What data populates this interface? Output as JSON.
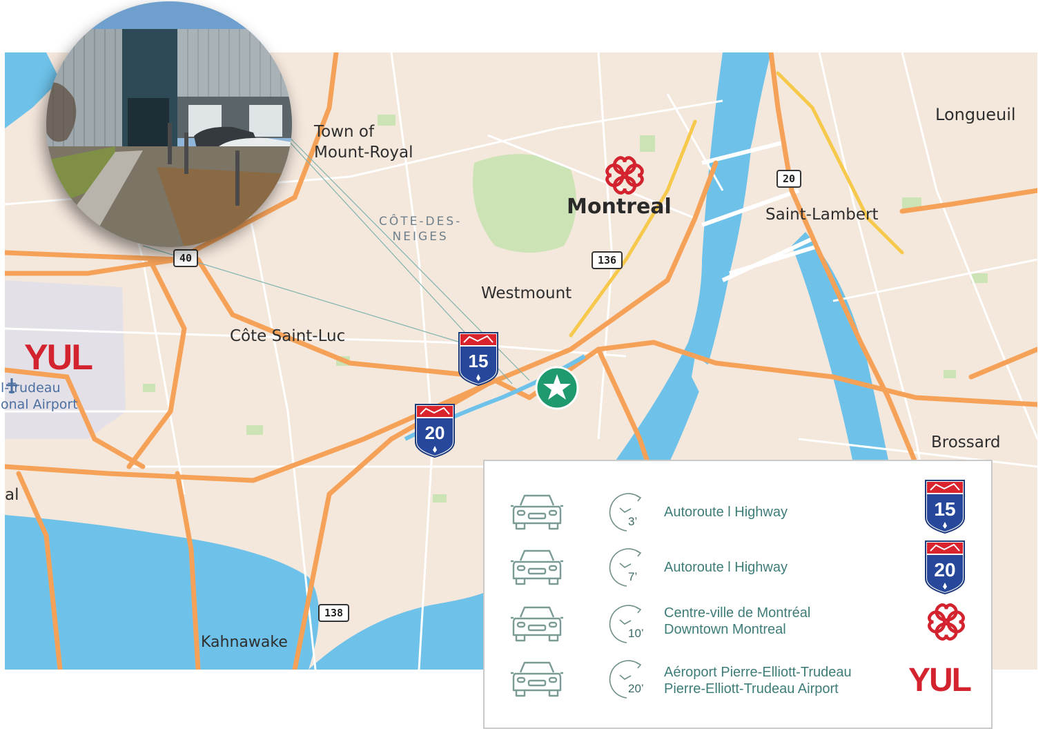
{
  "map": {
    "places": {
      "town_of_mount_royal": "Town of\nMount-Royal",
      "longueuil": "Longueuil",
      "montreal": "Montreal",
      "saint_lambert": "Saint-Lambert",
      "cote_des_neiges": "CÔTE-DES-\nNEIGES",
      "westmount": "Westmount",
      "cote_saint_luc": "Côte Saint-Luc",
      "brossard": "Brossard",
      "kahnawake": "Kahnawake",
      "airport_partial": "l-Trudeau\nonal Airport",
      "left_edge_partial": "al",
      "yul": "YUL"
    },
    "routes": {
      "r20": "20",
      "r40": "40",
      "r136": "136",
      "r138": "138"
    },
    "autoroutes": {
      "a15": "15",
      "a20": "20"
    },
    "colors": {
      "land": "#f4e7dc",
      "water": "#6ec2ea",
      "highway": "#f5a258",
      "park": "#cce3b6",
      "marker": "#1e9a6e"
    }
  },
  "photo": {
    "icon": "building-photo"
  },
  "legend": {
    "rows": [
      {
        "icon": "car-icon",
        "minutes": "3’",
        "lines": [
          "Autoroute l Highway"
        ],
        "logo": "autoroute-15-shield",
        "logo_text": "15"
      },
      {
        "icon": "car-icon",
        "minutes": "7’",
        "lines": [
          "Autoroute l Highway"
        ],
        "logo": "autoroute-20-shield",
        "logo_text": "20"
      },
      {
        "icon": "car-icon",
        "minutes": "10’",
        "lines": [
          "Centre-ville de Montréal",
          "Downtown Montreal"
        ],
        "logo": "montreal-logo"
      },
      {
        "icon": "car-icon",
        "minutes": "20’",
        "lines": [
          "Aéroport Pierre-Elliott-Trudeau",
          "Pierre-Elliott-Trudeau Airport"
        ],
        "logo": "yul-logo",
        "logo_text": "YUL"
      }
    ]
  }
}
